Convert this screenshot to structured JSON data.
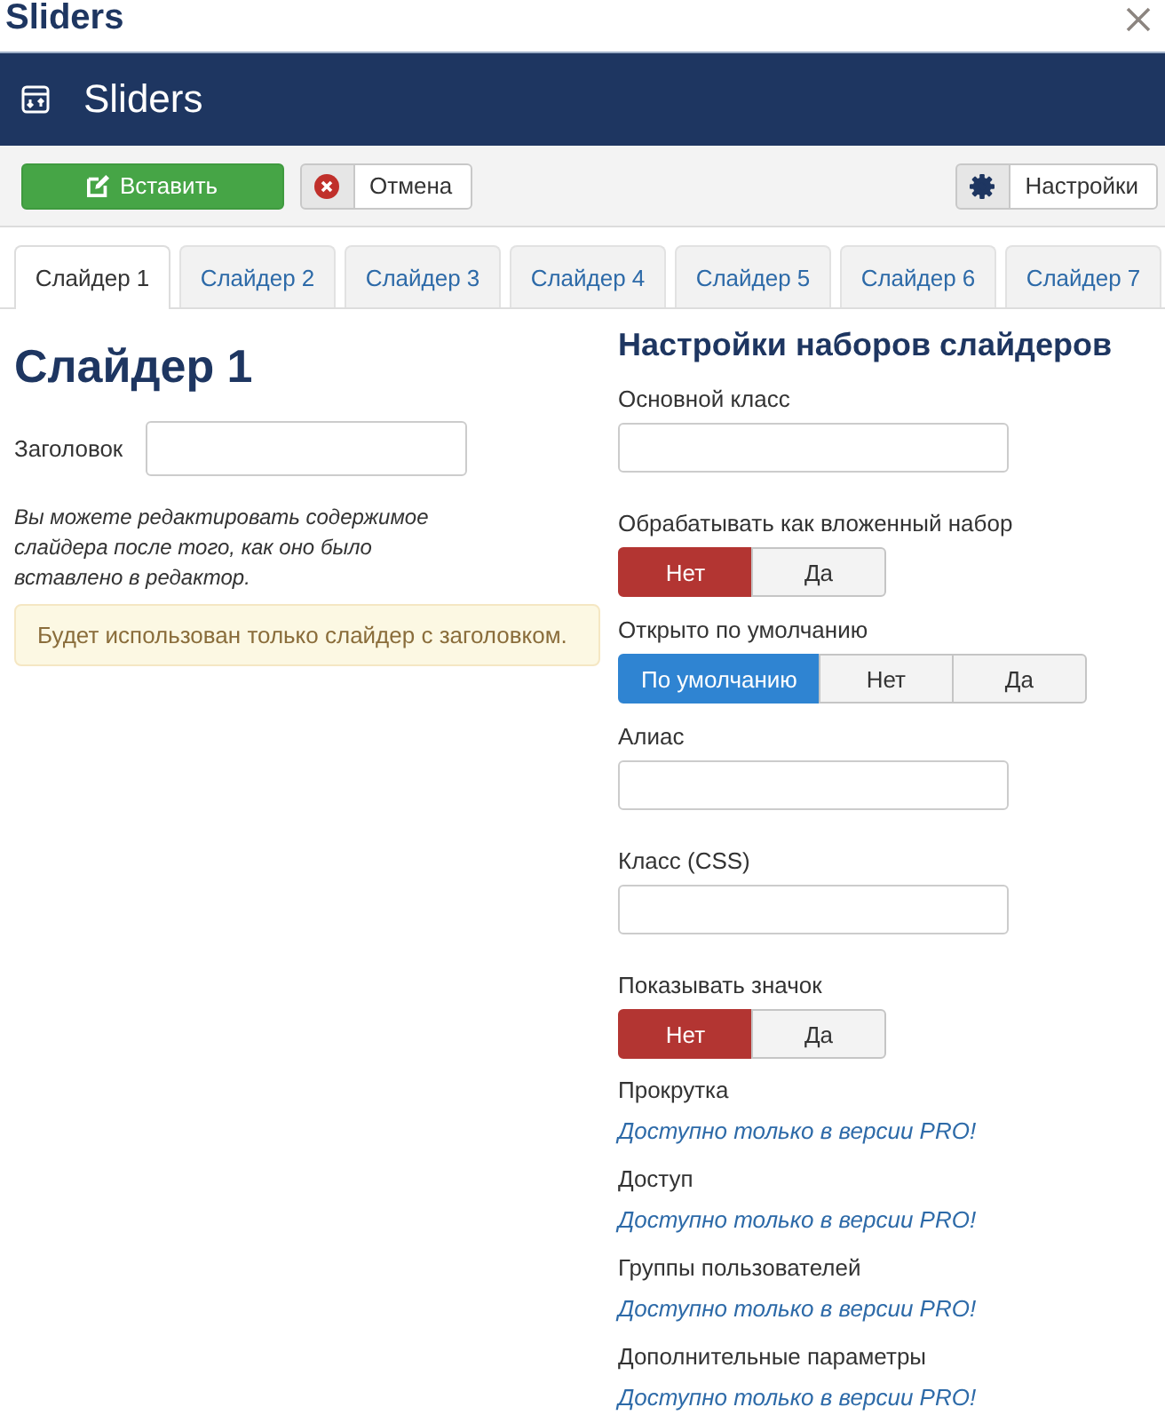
{
  "dialog": {
    "title": "Sliders"
  },
  "header": {
    "title": "Sliders"
  },
  "toolbar": {
    "buttons": [
      {
        "kind": "insert",
        "label": "Вставить"
      },
      {
        "kind": "cancel",
        "label": "Отмена"
      },
      {
        "kind": "settings",
        "label": "Настройки"
      }
    ]
  },
  "tabs": [
    {
      "label": "Слайдер 1",
      "selected": true
    },
    {
      "label": "Слайдер 2",
      "selected": false
    },
    {
      "label": "Слайдер 3",
      "selected": false
    },
    {
      "label": "Слайдер 4",
      "selected": false
    },
    {
      "label": "Слайдер 5",
      "selected": false
    },
    {
      "label": "Слайдер 6",
      "selected": false
    },
    {
      "label": "Слайдер 7",
      "selected": false
    }
  ],
  "slider_panel": {
    "heading": "Слайдер 1",
    "title_label": "Заголовок",
    "note": "Вы можете редактировать содержимое слайдера после того, как оно было вставлено в редактор.",
    "alert": "Будет использован только слайдер с заголовком."
  },
  "settings_panel": {
    "heading": "Настройки наборов слайдеров",
    "fields": [
      {
        "kind": "text",
        "label": "Основной класс"
      },
      {
        "kind": "toggle",
        "label": "Обрабатывать как вложенный набор",
        "options": [
          {
            "kind": "negative",
            "label": "Нет",
            "selected": true
          },
          {
            "kind": "positive",
            "label": "Да",
            "selected": false
          }
        ]
      },
      {
        "kind": "toggle",
        "label": "Открыто по умолчанию",
        "options": [
          {
            "kind": "neutral",
            "label": "По умолчанию",
            "selected": true
          },
          {
            "kind": "negative",
            "label": "Нет",
            "selected": false
          },
          {
            "kind": "positive",
            "label": "Да",
            "selected": false
          }
        ]
      },
      {
        "kind": "text",
        "label": "Алиас"
      },
      {
        "kind": "text",
        "label": "Класс (CSS)"
      },
      {
        "kind": "toggle",
        "label": "Показывать значок",
        "options": [
          {
            "kind": "negative",
            "label": "Нет",
            "selected": true
          },
          {
            "kind": "positive",
            "label": "Да",
            "selected": false
          }
        ]
      },
      {
        "kind": "pro",
        "label": "Прокрутка",
        "note": "Доступно только в версии PRO!"
      },
      {
        "kind": "pro",
        "label": "Доступ",
        "note": "Доступно только в версии PRO!"
      },
      {
        "kind": "pro",
        "label": "Группы пользователей",
        "note": "Доступно только в версии PRO!"
      },
      {
        "kind": "pro",
        "label": "Дополнительные параметры",
        "note": "Доступно только в версии PRO!"
      }
    ]
  }
}
